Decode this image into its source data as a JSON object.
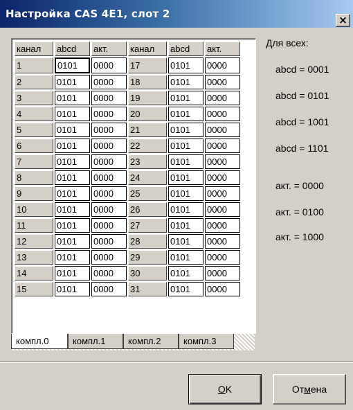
{
  "window": {
    "title": "Настройка CAS 4E1, слот 2",
    "close_label": "×"
  },
  "table": {
    "headers": [
      "канал",
      "abcd",
      "акт.",
      "канал",
      "abcd",
      "акт."
    ],
    "rows": [
      [
        "1",
        "0101",
        "0000",
        "17",
        "0101",
        "0000"
      ],
      [
        "2",
        "0101",
        "0000",
        "18",
        "0101",
        "0000"
      ],
      [
        "3",
        "0101",
        "0000",
        "19",
        "0101",
        "0000"
      ],
      [
        "4",
        "0101",
        "0000",
        "20",
        "0101",
        "0000"
      ],
      [
        "5",
        "0101",
        "0000",
        "21",
        "0101",
        "0000"
      ],
      [
        "6",
        "0101",
        "0000",
        "22",
        "0101",
        "0000"
      ],
      [
        "7",
        "0101",
        "0000",
        "23",
        "0101",
        "0000"
      ],
      [
        "8",
        "0101",
        "0000",
        "24",
        "0101",
        "0000"
      ],
      [
        "9",
        "0101",
        "0000",
        "25",
        "0101",
        "0000"
      ],
      [
        "10",
        "0101",
        "0000",
        "26",
        "0101",
        "0000"
      ],
      [
        "11",
        "0101",
        "0000",
        "27",
        "0101",
        "0000"
      ],
      [
        "12",
        "0101",
        "0000",
        "28",
        "0101",
        "0000"
      ],
      [
        "13",
        "0101",
        "0000",
        "29",
        "0101",
        "0000"
      ],
      [
        "14",
        "0101",
        "0000",
        "30",
        "0101",
        "0000"
      ],
      [
        "15",
        "0101",
        "0000",
        "31",
        "0101",
        "0000"
      ]
    ]
  },
  "tabs": {
    "items": [
      "компл.0",
      "компл.1",
      "компл.2",
      "компл.3"
    ],
    "active": 0
  },
  "side": {
    "label": "Для всех:",
    "buttons": [
      "abcd = 0001",
      "abcd = 0101",
      "abcd = 1001",
      "abcd = 1101",
      "акт. = 0000",
      "акт. = 0100",
      "акт. = 1000"
    ]
  },
  "buttons": {
    "ok": "OK",
    "ok_accel": "O",
    "cancel_pre": "От",
    "cancel_accel": "м",
    "cancel_post": "ена"
  }
}
